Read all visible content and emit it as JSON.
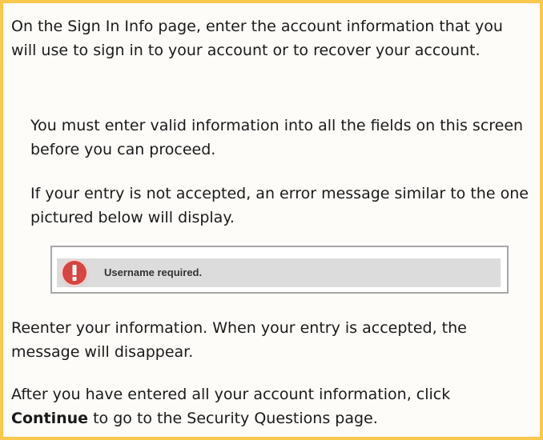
{
  "instructions": {
    "para1": "On the Sign In Info page, enter the account information that you will use to sign in to your account or to recover your account.",
    "para2": "You must enter valid information into all the fields on this screen before you can proceed.",
    "para3": "If your entry is not accepted, an error message similar to the one pictured below will display.",
    "para4": "Reenter your information. When your entry is accepted, the message will disappear.",
    "para5_before": "After you have entered all your account information, click ",
    "para5_bold": "Continue",
    "para5_after": " to go to the Security Questions page."
  },
  "error_example": {
    "message": "Username required.",
    "icon": "exclamation-circle-icon",
    "icon_color": "#d64541"
  },
  "colors": {
    "border": "#f9c84c",
    "error_bar": "#dcdcdc"
  }
}
